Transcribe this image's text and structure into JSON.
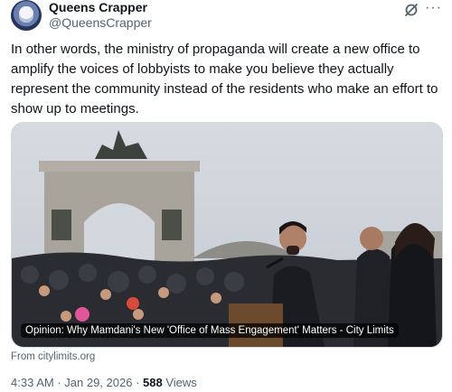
{
  "author": {
    "name": "Queens Crapper",
    "handle": "@QueensCrapper"
  },
  "tweet": {
    "text": "In other words, the ministry of propaganda will create a new office to\namplify the voices of lobbyists to make you believe they actually\nrepresent the community instead of the residents who make an effort to\nshow up to meetings."
  },
  "card": {
    "caption": "Opinion: Why Mamdani's New 'Office of Mass Engagement' Matters - City Limits",
    "source": "From citylimits.org"
  },
  "meta": {
    "time": "4:33 AM",
    "sep1": " · ",
    "date": "Jan 29, 2026",
    "sep2": " · ",
    "views_count": "588",
    "views_label": " Views"
  },
  "icons": {
    "grok": "grok-icon",
    "more": "more-icon"
  }
}
